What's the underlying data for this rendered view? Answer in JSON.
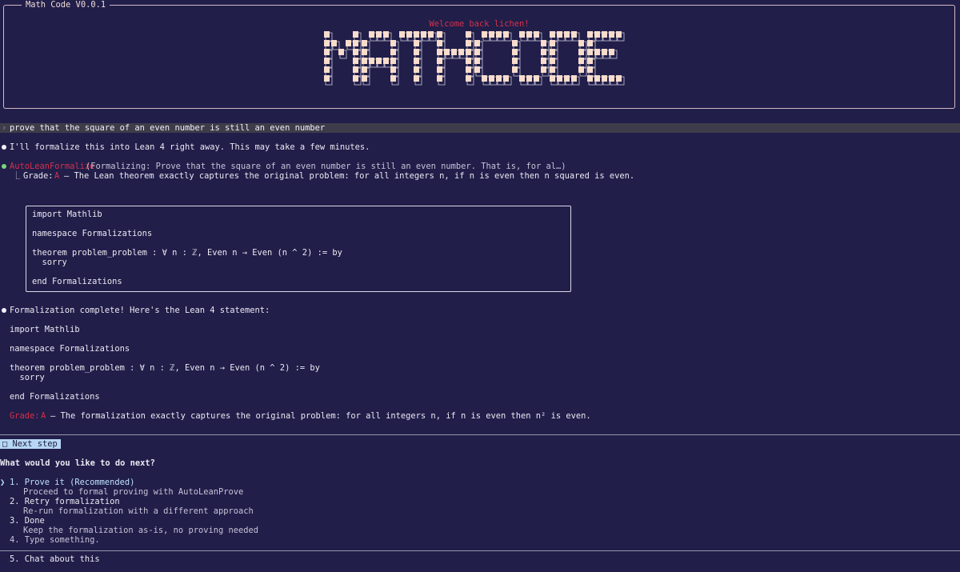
{
  "window": {
    "title": "Math Code V0.0.1"
  },
  "header": {
    "welcome": "Welcome back lichen!",
    "logo_text": "MATHCODE"
  },
  "prompt": {
    "text": "prove that the square of an even number is still an even number"
  },
  "messages": {
    "intro": "I'll formalize this into Lean 4 right away. This may take a few minutes.",
    "tool": {
      "name": "AutoLeanFormalize",
      "args": "(Formalizing: Prove that the square of an even number is still an even number. That is, for al…)",
      "grade_label": "Grade:",
      "grade_value": "A",
      "grade_text": "— The Lean theorem exactly captures the original problem: for all integers n, if n is even then n squared is even."
    },
    "code_lines": [
      "import Mathlib",
      "namespace Formalizations",
      "theorem problem_problem : ∀ n : ℤ, Even n → Even (n ^ 2) := by",
      "  sorry",
      "end Formalizations"
    ],
    "complete": "Formalization complete! Here's the Lean 4 statement:",
    "final_grade_label": "Grade:",
    "final_grade_value": "A",
    "final_grade_text": "— The formalization exactly captures the original problem: for all integers n, if n is even then n² is even."
  },
  "next_step": {
    "tab_label": "□ Next step",
    "question": "What would you like to do next?",
    "selected_marker": "❯",
    "options": [
      {
        "label": "1. Prove it (Recommended)",
        "desc": "Proceed to formal proving with AutoLeanProve"
      },
      {
        "label": "2. Retry formalization",
        "desc": "Re-run formalization with a different approach"
      },
      {
        "label": "3. Done",
        "desc": "Keep the formalization as-is, no proving needed"
      },
      {
        "label": "4. Type something.",
        "desc": ""
      }
    ],
    "chat_option": "5. Chat about this"
  },
  "colors": {
    "background": "#211e4a",
    "accent_red": "#d6304a",
    "logo_fill": "#f8dccc",
    "selection_blue": "#b7d6f5"
  }
}
